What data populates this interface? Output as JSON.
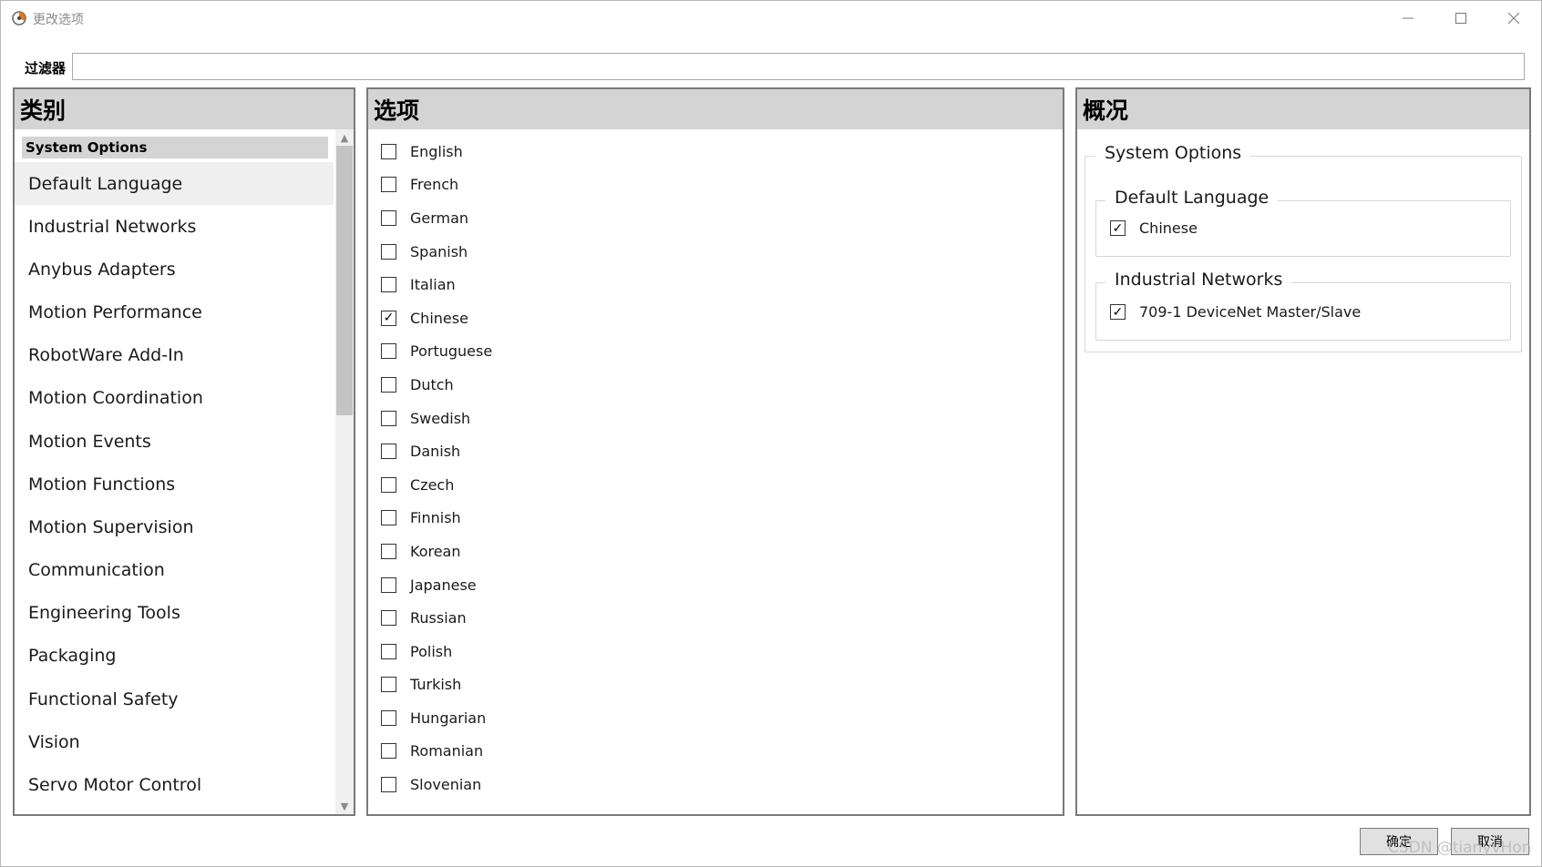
{
  "window": {
    "title": "更改选项"
  },
  "filter": {
    "label": "过滤器",
    "value": ""
  },
  "categories": {
    "header": "类别",
    "group_label": "System Options",
    "items": [
      "Default Language",
      "Industrial Networks",
      "Anybus Adapters",
      "Motion Performance",
      "RobotWare Add-In",
      "Motion Coordination",
      "Motion Events",
      "Motion Functions",
      "Motion Supervision",
      "Communication",
      "Engineering Tools",
      "Packaging",
      "Functional Safety",
      "Vision",
      "Servo Motor Control"
    ],
    "selected": "Default Language"
  },
  "options": {
    "header": "选项",
    "items": [
      {
        "label": "English",
        "checked": false
      },
      {
        "label": "French",
        "checked": false
      },
      {
        "label": "German",
        "checked": false
      },
      {
        "label": "Spanish",
        "checked": false
      },
      {
        "label": "Italian",
        "checked": false
      },
      {
        "label": "Chinese",
        "checked": true
      },
      {
        "label": "Portuguese",
        "checked": false
      },
      {
        "label": "Dutch",
        "checked": false
      },
      {
        "label": "Swedish",
        "checked": false
      },
      {
        "label": "Danish",
        "checked": false
      },
      {
        "label": "Czech",
        "checked": false
      },
      {
        "label": "Finnish",
        "checked": false
      },
      {
        "label": "Korean",
        "checked": false
      },
      {
        "label": "Japanese",
        "checked": false
      },
      {
        "label": "Russian",
        "checked": false
      },
      {
        "label": "Polish",
        "checked": false
      },
      {
        "label": "Turkish",
        "checked": false
      },
      {
        "label": "Hungarian",
        "checked": false
      },
      {
        "label": "Romanian",
        "checked": false
      },
      {
        "label": "Slovenian",
        "checked": false
      }
    ]
  },
  "overview": {
    "header": "概况",
    "group_title": "System Options",
    "sections": [
      {
        "title": "Default Language",
        "item": "Chinese",
        "checked": true
      },
      {
        "title": "Industrial Networks",
        "item": "709-1 DeviceNet Master/Slave",
        "checked": true
      }
    ]
  },
  "buttons": {
    "ok": "确定",
    "cancel": "取消"
  },
  "watermark": "CSDN @tianyvHon"
}
